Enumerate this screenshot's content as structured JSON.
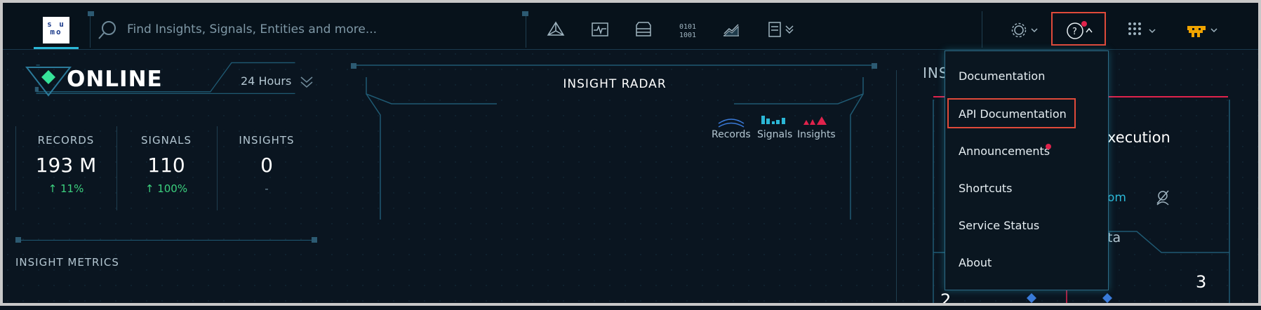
{
  "header": {
    "logo_text_top": "s u",
    "logo_text_bottom": "mo",
    "search": {
      "placeholder": "Find Insights, Signals, Entities and more..."
    }
  },
  "status": {
    "label": "ONLINE",
    "time_range": "24 Hours"
  },
  "metrics": [
    {
      "title": "RECORDS",
      "value": "193 M",
      "delta": "↑ 11%"
    },
    {
      "title": "SIGNALS",
      "value": "110",
      "delta": "↑ 100%"
    },
    {
      "title": "INSIGHTS",
      "value": "0",
      "delta": "-"
    }
  ],
  "insight_metrics_label": "INSIGHT METRICS",
  "radar": {
    "title": "INSIGHT RADAR",
    "legend": [
      "Records",
      "Signals",
      "Insights"
    ]
  },
  "right_panel": {
    "heading_partial": "INS",
    "execution_partial": "xecution",
    "link_partial": "om",
    "tab_partial": "ta",
    "num_a": "3",
    "num_b": "2"
  },
  "help_menu": {
    "items": [
      "Documentation",
      "API Documentation",
      "Announcements",
      "Shortcuts",
      "Service Status",
      "About"
    ]
  },
  "colors": {
    "accent": "#2bb7d6",
    "highlight": "#e04a3a",
    "positive": "#3cd07e",
    "alert": "#e0234c"
  },
  "icons": [
    "search-icon",
    "network-icon",
    "activity-icon",
    "server-icon",
    "binary-icon",
    "chart-icon",
    "document-icon",
    "gear-icon",
    "help-icon",
    "apps-grid-icon",
    "user-avatar-icon"
  ]
}
